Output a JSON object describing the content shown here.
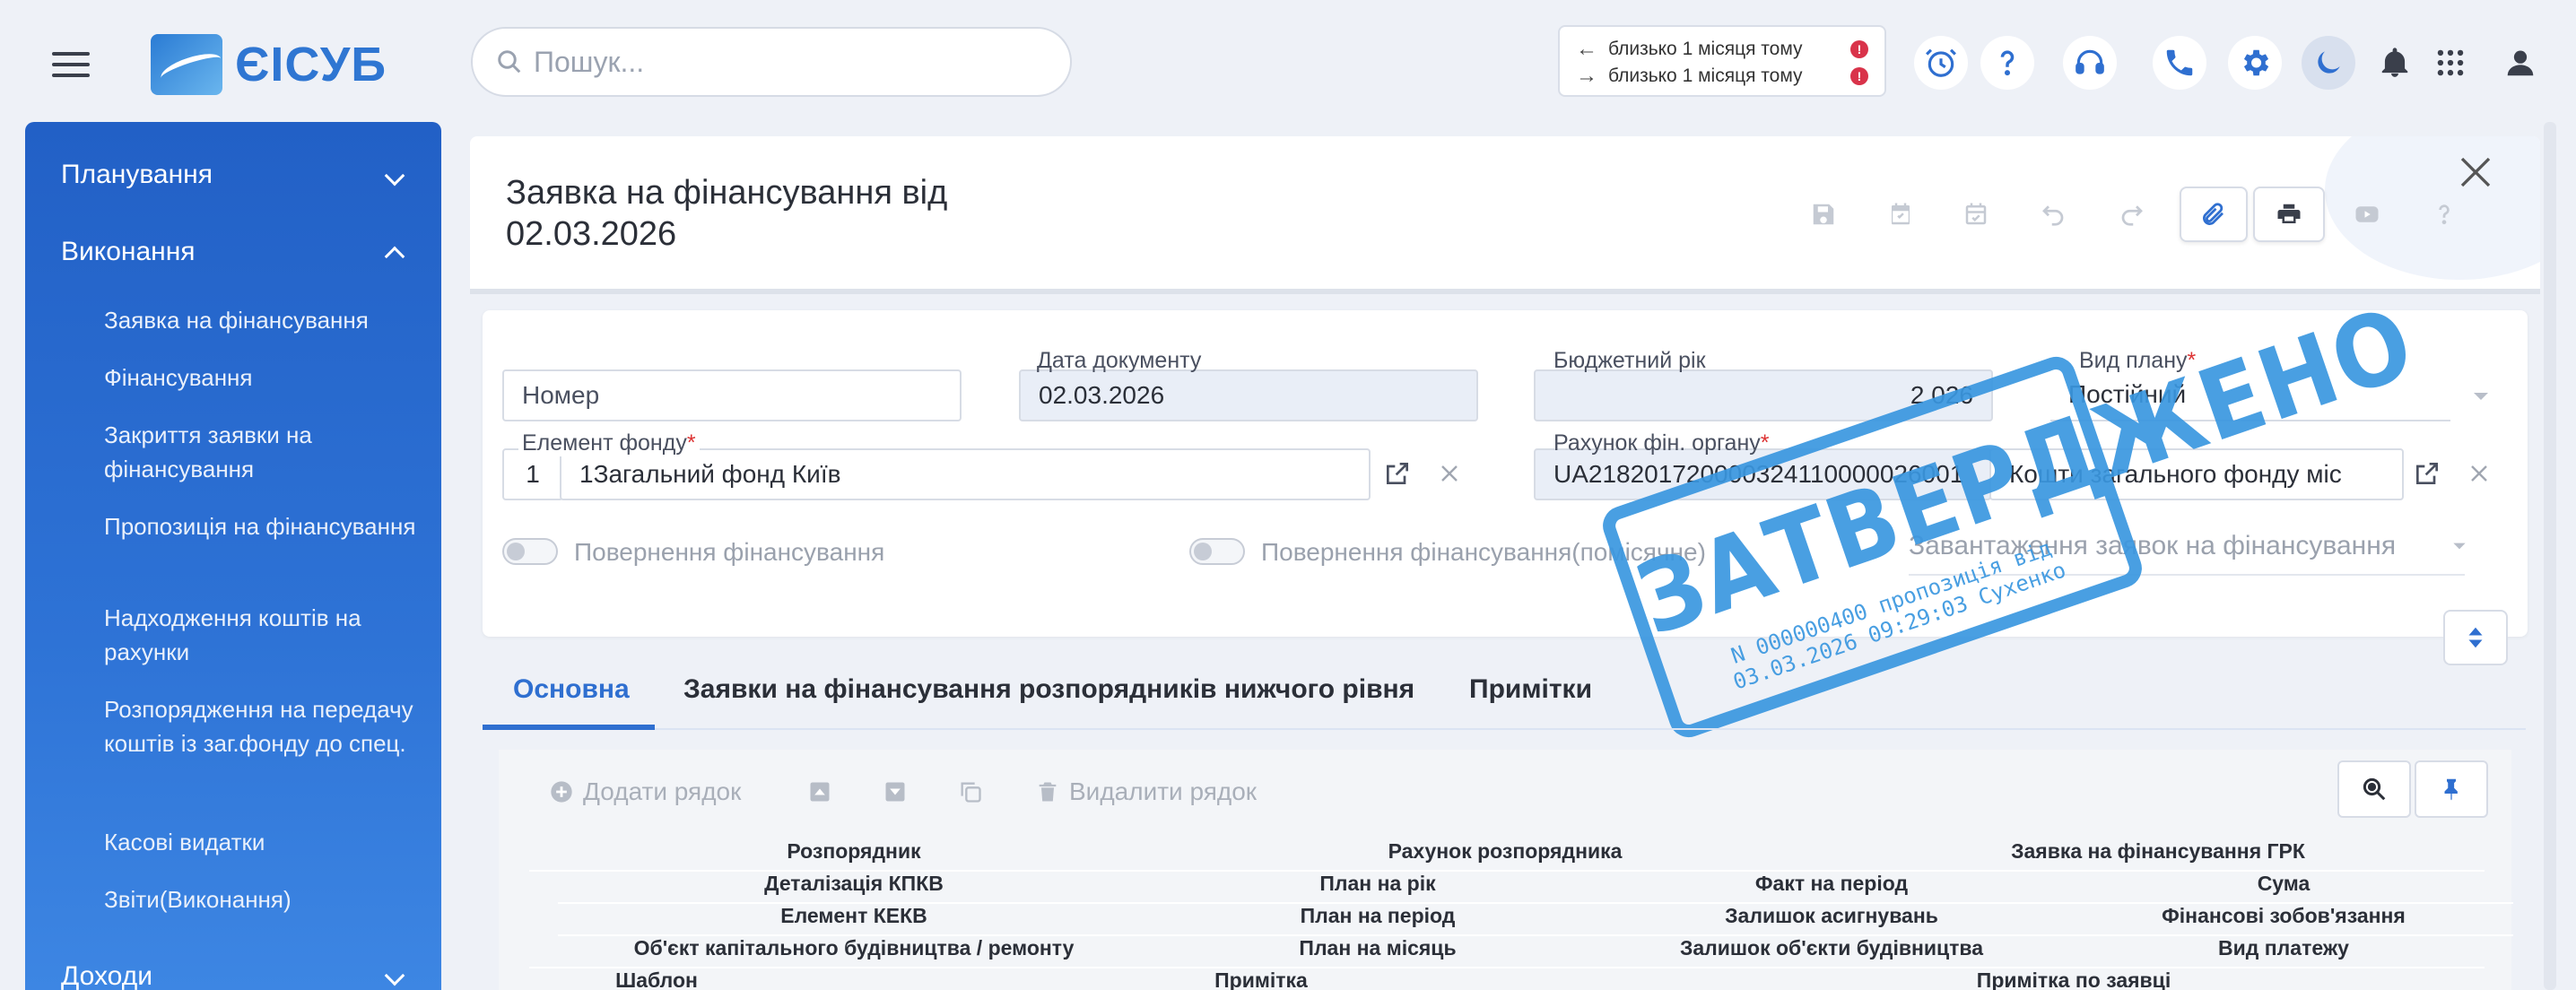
{
  "app": {
    "logo_text": "ЄІСУБ"
  },
  "search": {
    "placeholder": "Пошук..."
  },
  "sync": {
    "outgoing": "близько 1 місяця тому",
    "incoming": "близько 1 місяця тому",
    "alert_symbol": "!"
  },
  "sidebar": {
    "sections": [
      {
        "label": "Планування",
        "expanded": false
      },
      {
        "label": "Виконання",
        "expanded": true
      },
      {
        "label": "Доходи",
        "expanded": false
      }
    ],
    "items": [
      "Заявка на фінансування",
      "Фінансування",
      "Закриття заявки на фінансування",
      "Пропозиція на фінансування",
      "Надходження коштів на рахунки",
      "Розпорядження на передачу коштів із заг.фонду до спец.",
      "Касові видатки",
      "Звіти(Виконання)"
    ]
  },
  "document": {
    "title": "Заявка на фінансування від 02.03.2026"
  },
  "form": {
    "number_placeholder": "Номер",
    "doc_date_label": "Дата документу",
    "doc_date_value": "02.03.2026",
    "budget_year_label": "Бюджетний рік",
    "budget_year_value": "2 026",
    "plan_type_label": "Вид плану",
    "plan_type_value": "Постійний",
    "fund_element_label": "Елемент фонду",
    "fund_element_code": "1",
    "fund_element_value": "1Загальний фонд Київ",
    "account_label": "Рахунок фін. органу",
    "account_number": "UA218201720000324110000026001",
    "account_name": "Кошти загального фонду міс",
    "required_mark": "*",
    "toggle_return": "Повернення фінансування",
    "toggle_return_monthly": "Повернення фінансування(помісячне)",
    "load_requests": "Завантаження заявок на фінансування"
  },
  "stamp": {
    "title": "ЗАТВЕРДЖЕНО",
    "subtitle": "N 000000400 пропозиція від 03.03.2026 09:29:03 Сухенко"
  },
  "tabs": [
    {
      "label": "Основна",
      "active": true
    },
    {
      "label": "Заявки на фінансування розпорядників нижчого рівня",
      "active": false
    },
    {
      "label": "Примітки",
      "active": false
    }
  ],
  "grid_toolbar": {
    "add_row": "Додати рядок",
    "delete_row": "Видалити рядок"
  },
  "grid_headers": {
    "row1": [
      "Розпорядник",
      "Рахунок розпорядника",
      "Заявка на фінансування ГРК"
    ],
    "row2": [
      "Деталізація КПКВ",
      "План на рік",
      "Факт на період",
      "Сума"
    ],
    "row3": [
      "Елемент КЕКВ",
      "План на період",
      "Залишок асигнувань",
      "Фінансові зобов'язання"
    ],
    "row4": [
      "Об'єкт капітального будівництва / ремонту",
      "План на місяць",
      "Залишок об'єкти будівництва",
      "Вид платежу"
    ],
    "row5": [
      "Шаблон",
      "Примітка",
      "Примітка по заявці"
    ]
  },
  "colors": {
    "accent": "#2f6fd0",
    "sidebar": "#2260c6",
    "stamp": "#3a97e0",
    "alert": "#d9334a"
  }
}
